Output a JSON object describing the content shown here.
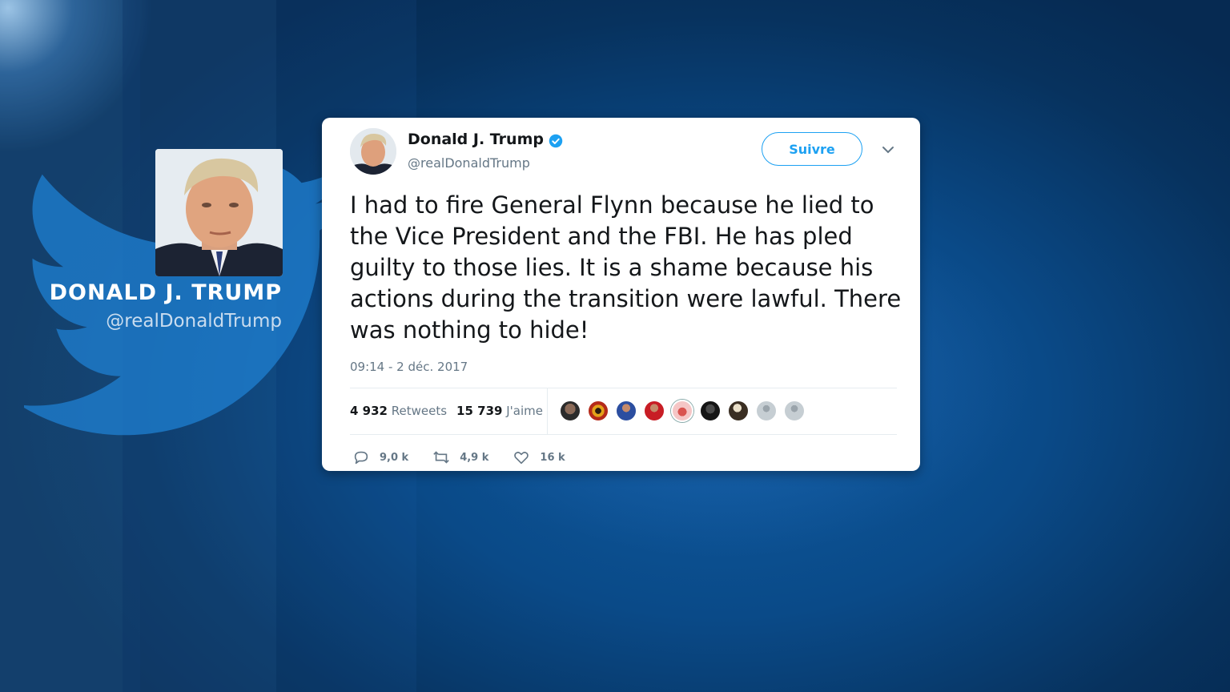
{
  "side_panel": {
    "name": "DONALD J. TRUMP",
    "handle": "@realDonaldTrump"
  },
  "tweet": {
    "author_name": "Donald J. Trump",
    "author_handle": "@realDonaldTrump",
    "follow_label": "Suivre",
    "text": "I had to fire General Flynn because he lied to the Vice President and the FBI. He has pled guilty to those lies. It is a shame because his actions during the transition were lawful. There was nothing to hide!",
    "timestamp": "09:14 - 2 déc. 2017",
    "retweets_count": "4 932",
    "retweets_label": "Retweets",
    "likes_count": "15 739",
    "likes_label": "J'aime",
    "reply_count": "9,0 k",
    "retweet_action_count": "4,9 k",
    "like_action_count": "16 k"
  },
  "colors": {
    "accent": "#1da1f2",
    "text": "#14171a",
    "muted": "#657786",
    "background": "#0a4a88"
  },
  "icons": {
    "brand": "bird-icon",
    "verified": "verified-badge-icon",
    "more": "chevron-down-icon",
    "reply": "reply-icon",
    "retweet": "retweet-icon",
    "like": "heart-icon"
  }
}
